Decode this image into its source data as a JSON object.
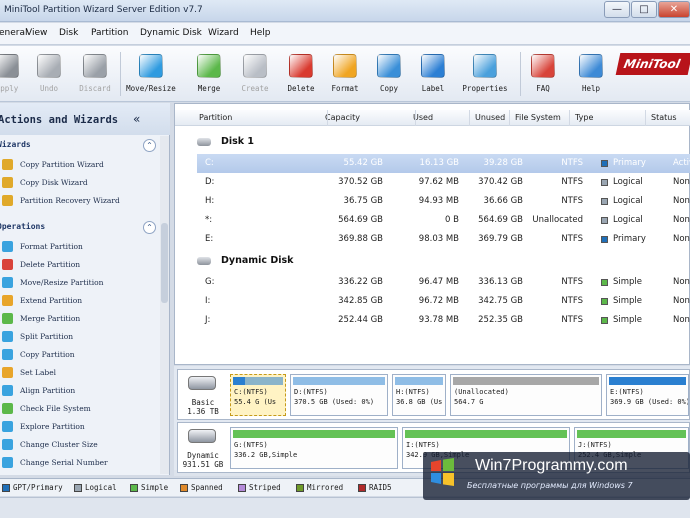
{
  "window": {
    "title": "MiniTool Partition Wizard Server Edition v7.7",
    "min": "—",
    "max": "□",
    "close": "✕"
  },
  "menu": [
    "General",
    "View",
    "Disk",
    "Partition",
    "Dynamic Disk",
    "Wizard",
    "Help"
  ],
  "toolbar": {
    "buttons": [
      {
        "label": "Apply",
        "icon": "apply-check-icon",
        "color": "#8a8f96",
        "disabled": true
      },
      {
        "label": "Undo",
        "icon": "undo-arrow-icon",
        "color": "#a8adb4",
        "disabled": true
      },
      {
        "label": "Discard",
        "icon": "discard-x-icon",
        "color": "#9aa0a8",
        "disabled": true
      },
      {
        "label": "Move/Resize",
        "icon": "move-resize-disk-icon",
        "color": "#2f9be0"
      },
      {
        "label": "Merge",
        "icon": "merge-disk-icon",
        "color": "#5bb84a"
      },
      {
        "label": "Create",
        "icon": "create-partition-icon",
        "color": "#b9bec6",
        "disabled": true
      },
      {
        "label": "Delete",
        "icon": "delete-partition-icon",
        "color": "#d93a2f"
      },
      {
        "label": "Format",
        "icon": "format-partition-icon",
        "color": "#f0a522"
      },
      {
        "label": "Copy",
        "icon": "copy-partition-icon",
        "color": "#3a8fd8"
      },
      {
        "label": "Label",
        "icon": "label-tag-icon",
        "color": "#2c7fd4"
      },
      {
        "label": "Properties",
        "icon": "properties-icon",
        "color": "#4aa0dc"
      },
      {
        "label": "FAQ",
        "icon": "faq-lifebuoy-icon",
        "color": "#d8443a"
      },
      {
        "label": "Help",
        "icon": "help-question-icon",
        "color": "#3d8ad6"
      }
    ],
    "logo": "MiniTool"
  },
  "sidebar": {
    "title": "Actions and Wizards",
    "collapse": "«",
    "sections": [
      {
        "title": "Wizards",
        "toggle": "⌃",
        "items": [
          {
            "label": "Copy Partition Wizard",
            "icon": "copy-partition-wizard-icon",
            "color": "#e0a92a"
          },
          {
            "label": "Copy Disk Wizard",
            "icon": "copy-disk-wizard-icon",
            "color": "#e0a92a"
          },
          {
            "label": "Partition Recovery Wizard",
            "icon": "partition-recovery-wizard-icon",
            "color": "#e0a92a"
          }
        ]
      },
      {
        "title": "Operations",
        "toggle": "⌃",
        "items": [
          {
            "label": "Format Partition",
            "icon": "format-partition-icon",
            "color": "#3aa3df"
          },
          {
            "label": "Delete Partition",
            "icon": "delete-partition-icon",
            "color": "#d9433a"
          },
          {
            "label": "Move/Resize Partition",
            "icon": "move-resize-partition-icon",
            "color": "#3aa3df"
          },
          {
            "label": "Extend Partition",
            "icon": "extend-partition-icon",
            "color": "#e8a52a"
          },
          {
            "label": "Merge Partition",
            "icon": "merge-partition-icon",
            "color": "#5cb84a"
          },
          {
            "label": "Split Partition",
            "icon": "split-partition-icon",
            "color": "#3aa3df"
          },
          {
            "label": "Copy Partition",
            "icon": "copy-partition-icon",
            "color": "#3aa3df"
          },
          {
            "label": "Set Label",
            "icon": "set-label-icon",
            "color": "#e8a52a"
          },
          {
            "label": "Align Partition",
            "icon": "align-partition-icon",
            "color": "#3aa3df"
          },
          {
            "label": "Check File System",
            "icon": "check-file-system-icon",
            "color": "#5cb84a"
          },
          {
            "label": "Explore Partition",
            "icon": "explore-partition-icon",
            "color": "#3aa3df"
          },
          {
            "label": "Change Cluster Size",
            "icon": "change-cluster-size-icon",
            "color": "#3aa3df"
          },
          {
            "label": "Change Serial Number",
            "icon": "change-serial-number-icon",
            "color": "#3aa3df"
          }
        ]
      }
    ]
  },
  "table": {
    "columns": [
      "Partition",
      "Capacity",
      "Used",
      "Unused",
      "File System",
      "Type",
      "Status"
    ],
    "groups": [
      {
        "title": "Disk 1",
        "rows": [
          {
            "partition": "C:",
            "capacity": "55.42 GB",
            "used": "16.13 GB",
            "unused": "39.28 GB",
            "fs": "NTFS",
            "type": "Primary",
            "typeColor": "#1f6fb8",
            "status": "Active & B",
            "selected": true
          },
          {
            "partition": "D:",
            "capacity": "370.52 GB",
            "used": "97.62 MB",
            "unused": "370.42 GB",
            "fs": "NTFS",
            "type": "Logical",
            "typeColor": "#9aa6b2",
            "status": "None"
          },
          {
            "partition": "H:",
            "capacity": "36.75 GB",
            "used": "94.93 MB",
            "unused": "36.66 GB",
            "fs": "NTFS",
            "type": "Logical",
            "typeColor": "#9aa6b2",
            "status": "None"
          },
          {
            "partition": "*:",
            "capacity": "564.69 GB",
            "used": "0 B",
            "unused": "564.69 GB",
            "fs": "Unallocated",
            "type": "Logical",
            "typeColor": "#9aa6b2",
            "status": "None"
          },
          {
            "partition": "E:",
            "capacity": "369.88 GB",
            "used": "98.03 MB",
            "unused": "369.79 GB",
            "fs": "NTFS",
            "type": "Primary",
            "typeColor": "#1f6fb8",
            "status": "None"
          }
        ]
      },
      {
        "title": "Dynamic Disk",
        "rows": [
          {
            "partition": "G:",
            "capacity": "336.22 GB",
            "used": "96.47 MB",
            "unused": "336.13 GB",
            "fs": "NTFS",
            "type": "Simple",
            "typeColor": "#5cb84a",
            "status": "None"
          },
          {
            "partition": "I:",
            "capacity": "342.85 GB",
            "used": "96.72 MB",
            "unused": "342.75 GB",
            "fs": "NTFS",
            "type": "Simple",
            "typeColor": "#5cb84a",
            "status": "None"
          },
          {
            "partition": "J:",
            "capacity": "252.44 GB",
            "used": "93.78 MB",
            "unused": "252.35 GB",
            "fs": "NTFS",
            "type": "Simple",
            "typeColor": "#5cb84a",
            "status": "None"
          }
        ]
      }
    ]
  },
  "diskmap": [
    {
      "name": "Basic",
      "size": "1.36 TB",
      "blocks": [
        {
          "l1": "C:(NTFS)",
          "l2": "55.4 G (Us",
          "color": "#2a7fd0",
          "fill": 0.29,
          "selected": true
        },
        {
          "l1": "D:(NTFS)",
          "l2": "370.5 GB (Used: 0%)",
          "color": "#8fbde6",
          "fill": 1
        },
        {
          "l1": "H:(NTFS)",
          "l2": "36.8 GB (Us",
          "color": "#8fbde6",
          "fill": 1
        },
        {
          "l1": "(Unallocated)",
          "l2": "564.7 G",
          "color": "#a7a7a7",
          "fill": 1
        },
        {
          "l1": "E:(NTFS)",
          "l2": "369.9 GB (Used: 0%)",
          "color": "#2a7fd0",
          "fill": 1
        }
      ]
    },
    {
      "name": "Dynamic",
      "size": "931.51 GB",
      "blocks": [
        {
          "l1": "G:(NTFS)",
          "l2": "336.2 GB,Simple",
          "color": "#64c256",
          "fill": 1
        },
        {
          "l1": "I:(NTFS)",
          "l2": "342.9 GB,Simple",
          "color": "#64c256",
          "fill": 1
        },
        {
          "l1": "J:(NTFS)",
          "l2": "252.4 GB,Simple",
          "color": "#64c256",
          "fill": 1
        }
      ]
    }
  ],
  "legend": [
    {
      "label": "GPT/Primary",
      "color": "#1f6fb8"
    },
    {
      "label": "Logical",
      "color": "#9aa6b2"
    },
    {
      "label": "Simple",
      "color": "#5cb84a"
    },
    {
      "label": "Spanned",
      "color": "#e08a2a"
    },
    {
      "label": "Striped",
      "color": "#b48ad8"
    },
    {
      "label": "Mirrored",
      "color": "#6f9a2a"
    },
    {
      "label": "RAID5",
      "color": "#b02a2a"
    }
  ],
  "watermark": {
    "title": "Win7Programmy.com",
    "subtitle": "Бесплатные программы для Windows 7"
  }
}
